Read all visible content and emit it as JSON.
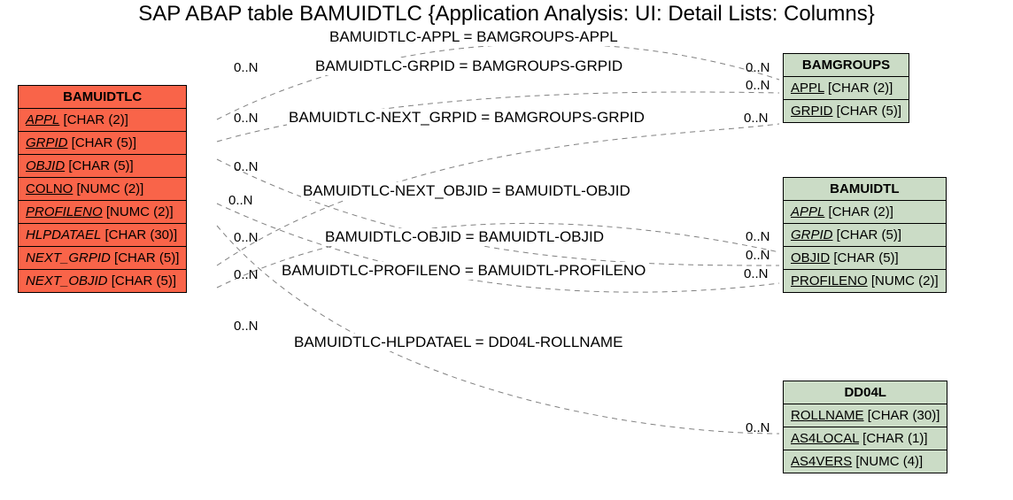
{
  "title": "SAP ABAP table BAMUIDTLC {Application Analysis: UI: Detail Lists: Columns}",
  "tables": {
    "main": {
      "name": "BAMUIDTLC",
      "rows": [
        {
          "name": "APPL",
          "type": "[CHAR (2)]",
          "u": true,
          "i": true
        },
        {
          "name": "GRPID",
          "type": "[CHAR (5)]",
          "u": true,
          "i": true
        },
        {
          "name": "OBJID",
          "type": "[CHAR (5)]",
          "u": true,
          "i": true
        },
        {
          "name": "COLNO",
          "type": "[NUMC (2)]",
          "u": true,
          "i": false
        },
        {
          "name": "PROFILENO",
          "type": "[NUMC (2)]",
          "u": true,
          "i": true
        },
        {
          "name": "HLPDATAEL",
          "type": "[CHAR (30)]",
          "u": false,
          "i": true
        },
        {
          "name": "NEXT_GRPID",
          "type": "[CHAR (5)]",
          "u": false,
          "i": true
        },
        {
          "name": "NEXT_OBJID",
          "type": "[CHAR (5)]",
          "u": false,
          "i": true
        }
      ]
    },
    "bamgroups": {
      "name": "BAMGROUPS",
      "rows": [
        {
          "name": "APPL",
          "type": "[CHAR (2)]",
          "u": true,
          "i": false
        },
        {
          "name": "GRPID",
          "type": "[CHAR (5)]",
          "u": true,
          "i": false
        }
      ]
    },
    "bamuidtl": {
      "name": "BAMUIDTL",
      "rows": [
        {
          "name": "APPL",
          "type": "[CHAR (2)]",
          "u": true,
          "i": true
        },
        {
          "name": "GRPID",
          "type": "[CHAR (5)]",
          "u": true,
          "i": true
        },
        {
          "name": "OBJID",
          "type": "[CHAR (5)]",
          "u": true,
          "i": false
        },
        {
          "name": "PROFILENO",
          "type": "[NUMC (2)]",
          "u": true,
          "i": false
        }
      ]
    },
    "dd04l": {
      "name": "DD04L",
      "rows": [
        {
          "name": "ROLLNAME",
          "type": "[CHAR (30)]",
          "u": true,
          "i": false
        },
        {
          "name": "AS4LOCAL",
          "type": "[CHAR (1)]",
          "u": true,
          "i": false
        },
        {
          "name": "AS4VERS",
          "type": "[NUMC (4)]",
          "u": true,
          "i": false
        }
      ]
    }
  },
  "rels": [
    {
      "label": "BAMUIDTLC-APPL = BAMGROUPS-APPL"
    },
    {
      "label": "BAMUIDTLC-GRPID = BAMGROUPS-GRPID"
    },
    {
      "label": "BAMUIDTLC-NEXT_GRPID = BAMGROUPS-GRPID"
    },
    {
      "label": "BAMUIDTLC-NEXT_OBJID = BAMUIDTL-OBJID"
    },
    {
      "label": "BAMUIDTLC-OBJID = BAMUIDTL-OBJID"
    },
    {
      "label": "BAMUIDTLC-PROFILENO = BAMUIDTL-PROFILENO"
    },
    {
      "label": "BAMUIDTLC-HLPDATAEL = DD04L-ROLLNAME"
    }
  ],
  "card": "0..N"
}
